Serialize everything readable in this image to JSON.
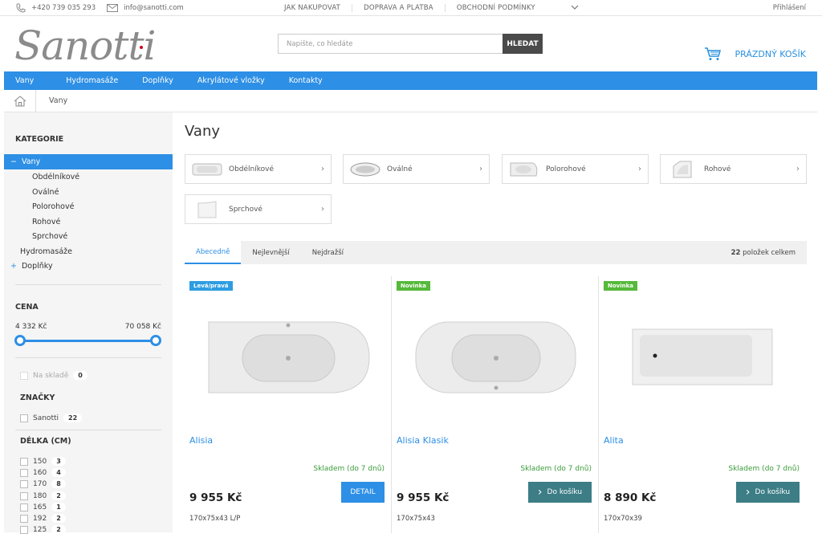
{
  "topbar": {
    "phone": "+420 739 035 293",
    "email": "info@sanotti.com",
    "links": [
      "JAK NAKUPOVAT",
      "DOPRAVA A PLATBA",
      "OBCHODNÍ PODMÍNKY"
    ],
    "login": "Přihlášení"
  },
  "header": {
    "logo": "Sanotti",
    "search_placeholder": "Napište, co hledáte",
    "search_button": "HLEDAT",
    "cart": "PRÁZDNÝ KOŠÍK"
  },
  "mainnav": [
    "Vany",
    "Hydromasáže",
    "Doplňky",
    "Akrylátové vložky",
    "Kontakty"
  ],
  "breadcrumb": {
    "current": "Vany"
  },
  "sidebar": {
    "categories_title": "KATEGORIE",
    "active_category": "Vany",
    "active_marker": "−",
    "subcategories": [
      "Obdélníkové",
      "Oválné",
      "Polorohové",
      "Rohové",
      "Sprchové"
    ],
    "other_categories": [
      "Hydromasáže",
      "Doplňky"
    ],
    "other_marker": "+",
    "price_title": "CENA",
    "price_min": "4 332 Kč",
    "price_max": "70 058 Kč",
    "in_stock_label": "Na skladě",
    "in_stock_count": "0",
    "brands_title": "ZNAČKY",
    "brand": {
      "label": "Sanotti",
      "count": "22"
    },
    "length_title": "DÉLKA (CM)",
    "lengths": [
      {
        "label": "150",
        "count": "3"
      },
      {
        "label": "160",
        "count": "4"
      },
      {
        "label": "170",
        "count": "8"
      },
      {
        "label": "180",
        "count": "2"
      },
      {
        "label": "165",
        "count": "1"
      },
      {
        "label": "192",
        "count": "2"
      },
      {
        "label": "125",
        "count": "2"
      }
    ]
  },
  "content": {
    "title": "Vany",
    "subcategories": [
      "Obdélníkové",
      "Oválné",
      "Polorohové",
      "Rohové",
      "Sprchové"
    ],
    "sort_tabs": [
      "Abecedně",
      "Nejlevnější",
      "Nejdražší"
    ],
    "total_count": "22",
    "total_suffix": "položek celkem"
  },
  "products": [
    {
      "flag": "Levá/pravá",
      "flag_color": "#2d9de2",
      "name": "Alisia",
      "stock": "Skladem (do 7 dnů)",
      "price": "9 955 Kč",
      "dims": "170x75x43 L/P",
      "button": "DETAIL",
      "button_color": "#2d8fe5"
    },
    {
      "flag": "Novinka",
      "flag_color": "#55b93a",
      "name": "Alisia Klasik",
      "stock": "Skladem (do 7 dnů)",
      "price": "9 955 Kč",
      "dims": "170x75x43",
      "button": "Do košíku",
      "button_color": "#3c7d86"
    },
    {
      "flag": "Novinka",
      "flag_color": "#55b93a",
      "name": "Alita",
      "stock": "Skladem (do 7 dnů)",
      "price": "8 890 Kč",
      "dims": "170x70x39",
      "button": "Do košíku",
      "button_color": "#3c7d86"
    }
  ]
}
